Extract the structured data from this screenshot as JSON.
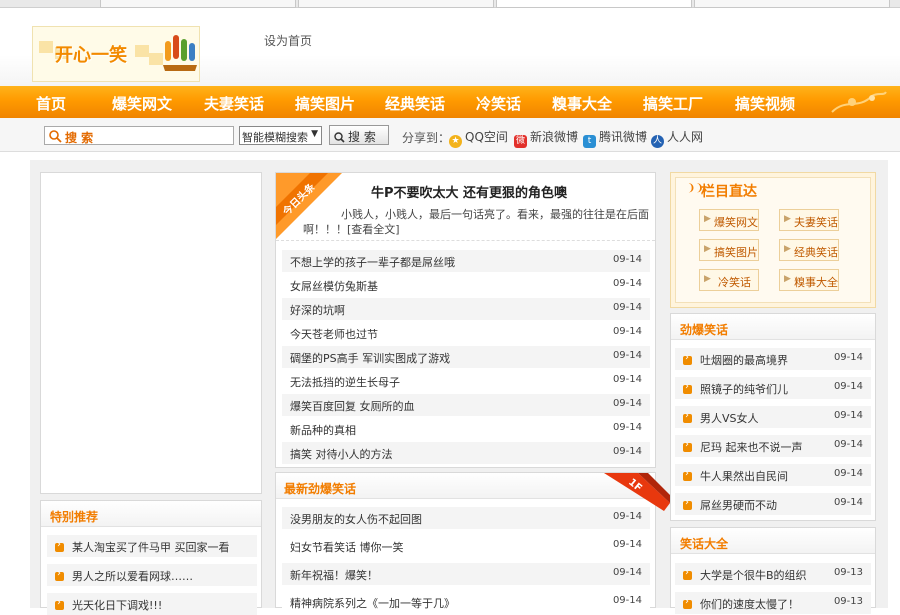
{
  "header": {
    "set_home": "设为首页",
    "logo_text": "开心一笑"
  },
  "nav": [
    "首页",
    "爆笑网文",
    "夫妻笑话",
    "搞笑图片",
    "经典笑话",
    "冷笑话",
    "糗事大全",
    "搞笑工厂",
    "搞笑视频"
  ],
  "search": {
    "placeholder": "搜 索",
    "mode": "智能模糊搜索",
    "button": "搜 索"
  },
  "share": {
    "label": "分享到：",
    "items": [
      "QQ空间",
      "新浪微博",
      "腾讯微博",
      "人人网"
    ]
  },
  "headline": {
    "badge": "今日头条",
    "title": "牛P不要吹太大 还有更狠的角色噢",
    "summary_line1": "小贱人，小贱人，最后一句话亮了。看来，最强的往往是在后面",
    "summary_line2": "啊！！！[查看全文]"
  },
  "middle_list": [
    {
      "title": "不想上学的孩子一辈子都是屌丝哦",
      "date": "09-14"
    },
    {
      "title": "女屌丝模仿兔斯基",
      "date": "09-14"
    },
    {
      "title": "好深的坑啊",
      "date": "09-14"
    },
    {
      "title": "今天苍老师也过节",
      "date": "09-14"
    },
    {
      "title": "碉堡的PS高手 军训实图成了游戏",
      "date": "09-14"
    },
    {
      "title": "无法抵挡的逆生长母子",
      "date": "09-14"
    },
    {
      "title": "爆笑百度回复 女厕所的血",
      "date": "09-14"
    },
    {
      "title": "新品种的真相",
      "date": "09-14"
    },
    {
      "title": "搞笑 对待小人的方法",
      "date": "09-14"
    }
  ],
  "latest": {
    "title": "最新劲爆笑话",
    "floor": "1F",
    "items": [
      {
        "title": "没男朋友的女人伤不起回图",
        "date": "09-14"
      },
      {
        "title": "妇女节看笑话 博你一笑",
        "date": "09-14"
      },
      {
        "title": "新年祝福！爆笑！",
        "date": "09-14"
      },
      {
        "title": "精神病院系列之《一加一等于几》",
        "date": "09-14"
      }
    ]
  },
  "special": {
    "title": "特别推荐",
    "items": [
      "某人淘宝买了件马甲 买回家一看",
      "男人之所以爱看网球……",
      "光天化日下调戏!!!"
    ]
  },
  "columns": {
    "title": "栏目直达",
    "items": [
      "爆笑网文",
      "夫妻笑话",
      "搞笑图片",
      "经典笑话",
      "冷笑话",
      "糗事大全"
    ]
  },
  "hot": {
    "title": "劲爆笑话",
    "items": [
      {
        "title": "吐烟圈的最高境界",
        "date": "09-14"
      },
      {
        "title": "照镜子的纯爷们儿",
        "date": "09-14"
      },
      {
        "title": "男人VS女人",
        "date": "09-14"
      },
      {
        "title": "尼玛 起来也不说一声",
        "date": "09-14"
      },
      {
        "title": "牛人果然出自民间",
        "date": "09-14"
      },
      {
        "title": "屌丝男硬而不动",
        "date": "09-14"
      }
    ]
  },
  "jokes": {
    "title": "笑话大全",
    "items": [
      {
        "title": "大学是个很牛B的组织",
        "date": "09-13"
      },
      {
        "title": "你们的速度太慢了！",
        "date": "09-13"
      }
    ]
  },
  "colors": {
    "accent": "#ff9a00",
    "title_orange": "#f27d00"
  }
}
